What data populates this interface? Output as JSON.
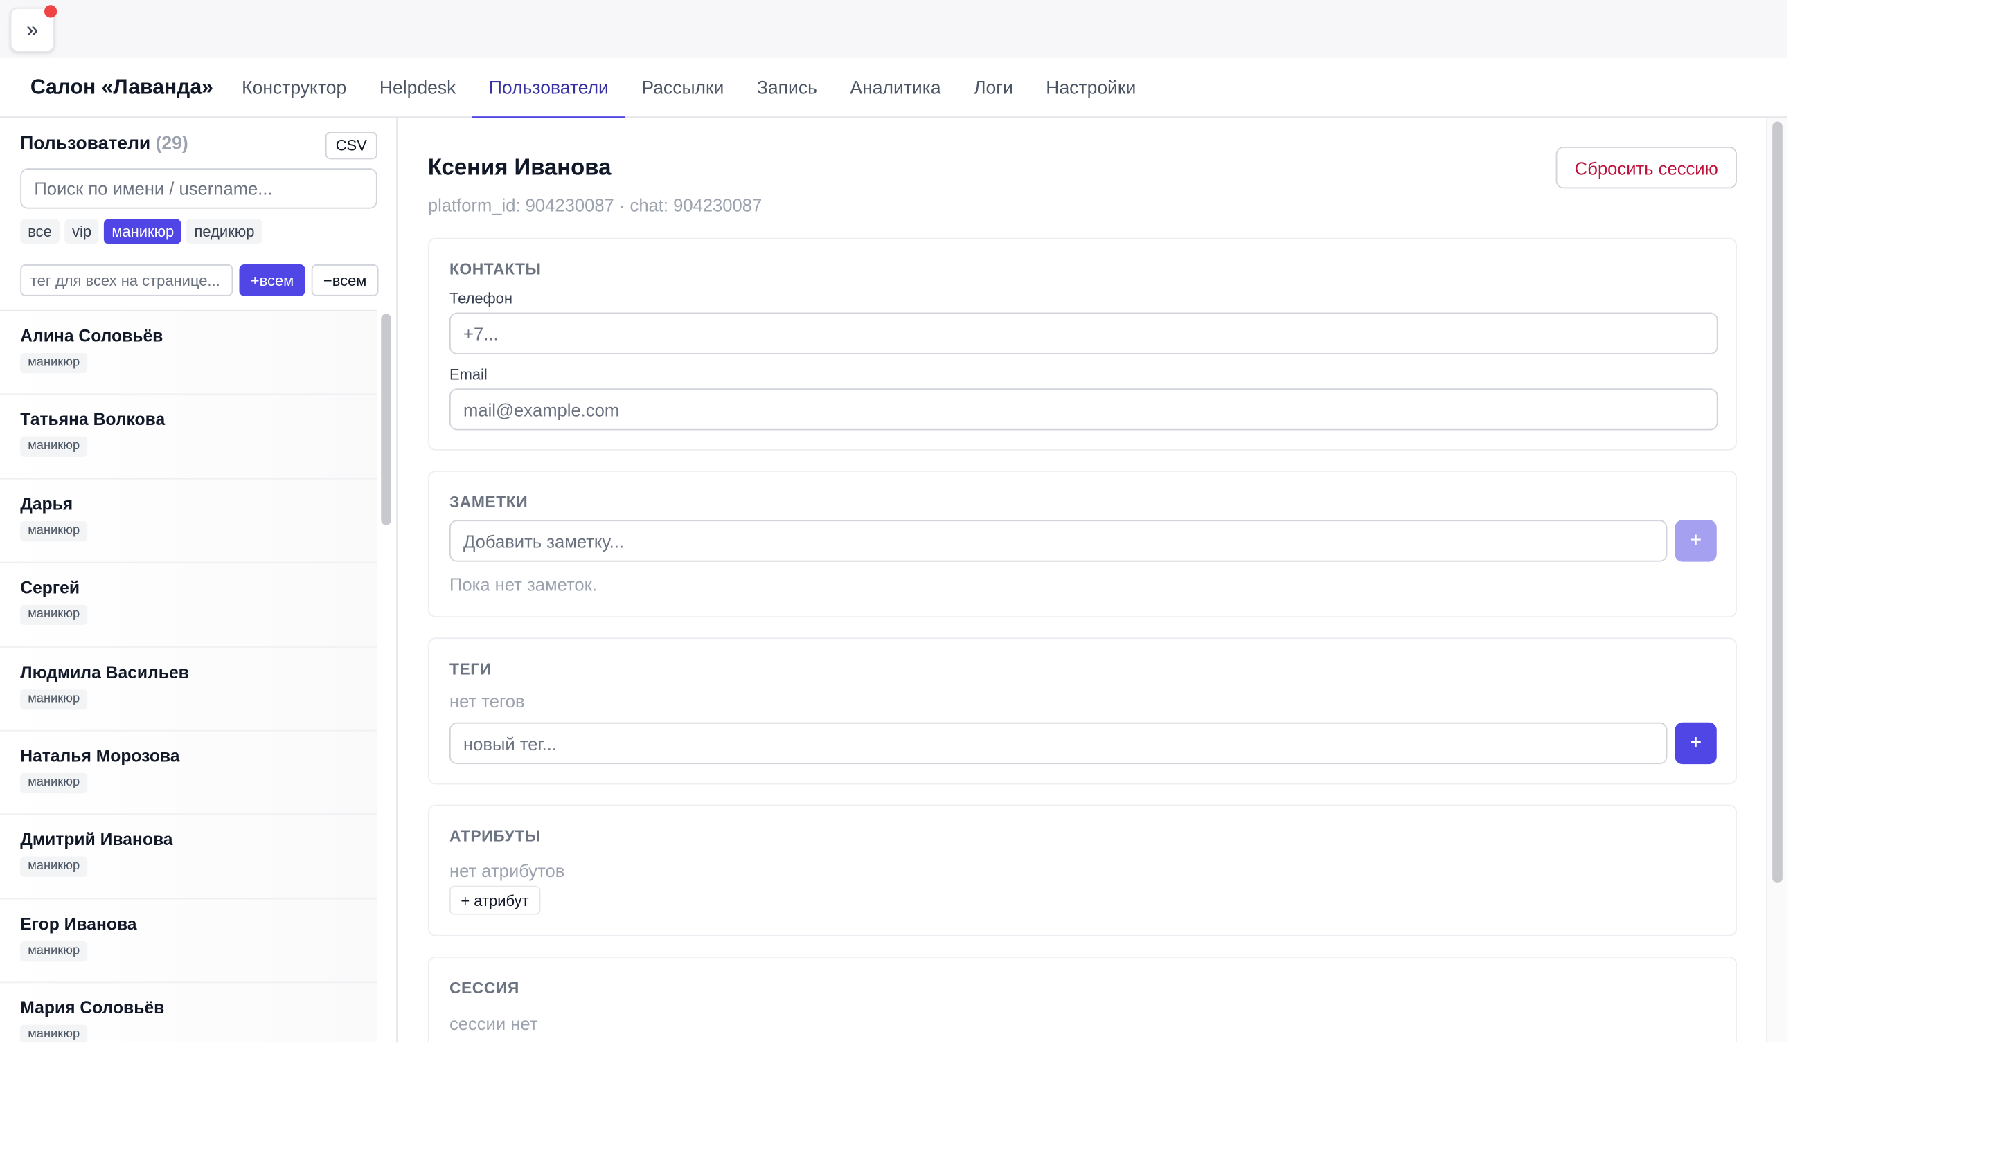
{
  "topbar": {
    "expand_label": "»",
    "has_notification": true
  },
  "navbar": {
    "brand": "Салон «Лаванда»",
    "tabs": [
      {
        "label": "Конструктор",
        "active": false
      },
      {
        "label": "Helpdesk",
        "active": false
      },
      {
        "label": "Пользователи",
        "active": true
      },
      {
        "label": "Рассылки",
        "active": false
      },
      {
        "label": "Запись",
        "active": false
      },
      {
        "label": "Аналитика",
        "active": false
      },
      {
        "label": "Логи",
        "active": false
      },
      {
        "label": "Настройки",
        "active": false
      }
    ]
  },
  "sidebar": {
    "title": "Пользователи",
    "count": "(29)",
    "csv_label": "CSV",
    "search_placeholder": "Поиск по имени / username...",
    "filters": [
      {
        "label": "все",
        "active": false
      },
      {
        "label": "vip",
        "active": false
      },
      {
        "label": "маникюр",
        "active": true
      },
      {
        "label": "педикюр",
        "active": false
      }
    ],
    "bulk_tag_placeholder": "тег для всех на странице...",
    "bulk_add_label": "+всем",
    "bulk_remove_label": "−всем",
    "users": [
      {
        "name": "Алина Соловьёв",
        "tag": "маникюр"
      },
      {
        "name": "Татьяна Волкова",
        "tag": "маникюр"
      },
      {
        "name": "Дарья",
        "tag": "маникюр"
      },
      {
        "name": "Сергей",
        "tag": "маникюр"
      },
      {
        "name": "Людмила Васильев",
        "tag": "маникюр"
      },
      {
        "name": "Наталья Морозова",
        "tag": "маникюр"
      },
      {
        "name": "Дмитрий Иванова",
        "tag": "маникюр"
      },
      {
        "name": "Егор Иванова",
        "tag": "маникюр"
      },
      {
        "name": "Мария Соловьёв",
        "tag": "маникюр"
      }
    ]
  },
  "detail": {
    "name": "Ксения Иванова",
    "meta": "platform_id: 904230087 · chat: 904230087",
    "reset_session_label": "Сбросить сессию",
    "contacts": {
      "heading": "КОНТАКТЫ",
      "phone_label": "Телефон",
      "phone_placeholder": "+7...",
      "email_label": "Email",
      "email_placeholder": "mail@example.com"
    },
    "notes": {
      "heading": "ЗАМЕТКИ",
      "input_placeholder": "Добавить заметку...",
      "add_label": "+",
      "empty_text": "Пока нет заметок."
    },
    "tags": {
      "heading": "ТЕГИ",
      "empty_text": "нет тегов",
      "input_placeholder": "новый тег...",
      "add_label": "+"
    },
    "attributes": {
      "heading": "АТРИБУТЫ",
      "empty_text": "нет атрибутов",
      "add_label": "+ атрибут"
    },
    "session": {
      "heading": "СЕССИЯ",
      "empty_text": "сессии нет"
    }
  },
  "colors": {
    "accent": "#4f46e5",
    "accent_disabled": "#a5a1f0",
    "danger_text": "#be123c",
    "notification": "#ef4444"
  }
}
